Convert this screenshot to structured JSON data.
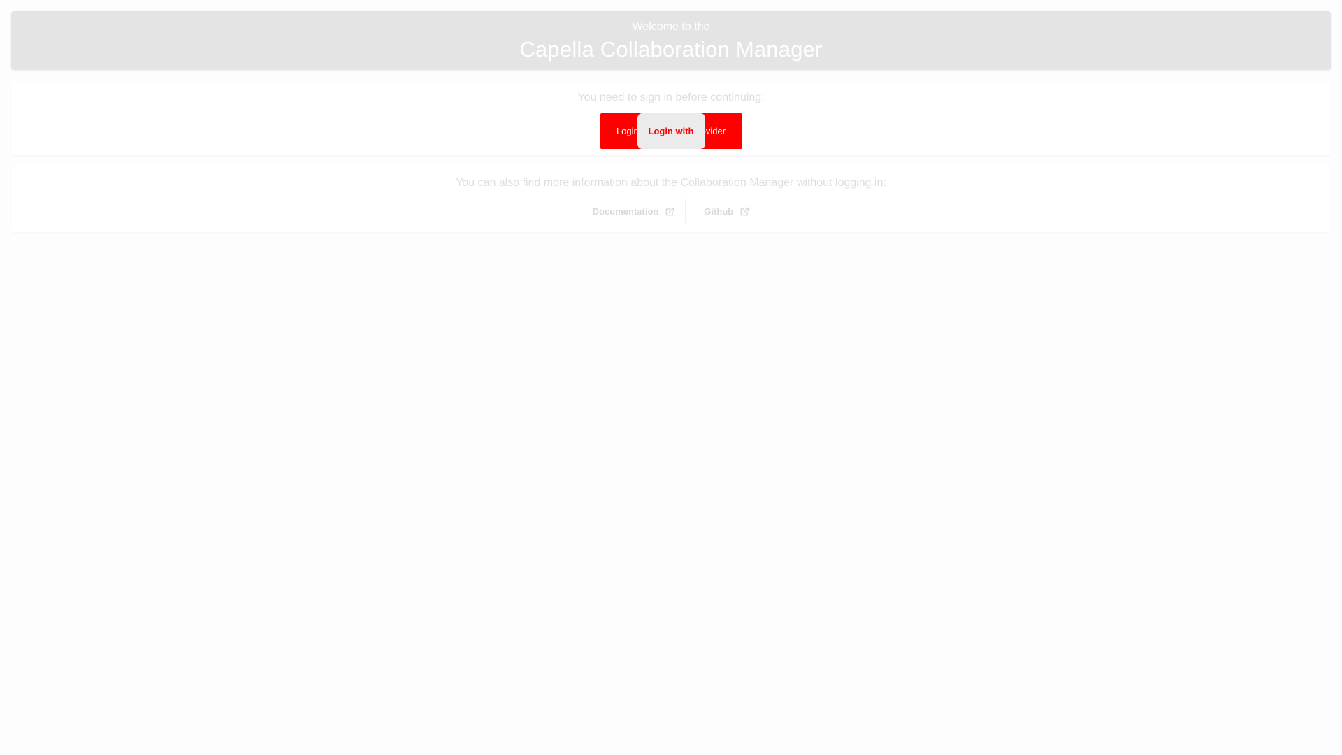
{
  "header": {
    "subtitle": "Welcome to the",
    "title": "Capella Collaboration Manager"
  },
  "login_card": {
    "prompt": "You need to sign in before continuing:",
    "login_button_label": "Login with Identity Provider",
    "overlay_label": "Login with"
  },
  "info_card": {
    "text": "You can also find more information about the Collaboration Manager without logging in:",
    "links": [
      {
        "label": "Documentation",
        "icon": "open-in-new-icon"
      },
      {
        "label": "Github",
        "icon": "open-in-new-icon"
      }
    ]
  },
  "colors": {
    "header_bg": "#e4e4e4",
    "login_accent": "#ff0000",
    "muted_text": "#dedede",
    "page_bg": "#fdfdfd"
  }
}
